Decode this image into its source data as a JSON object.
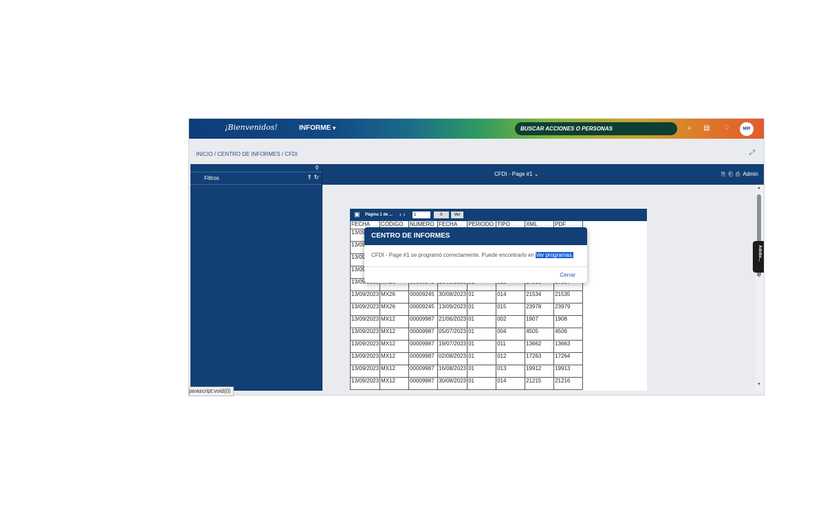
{
  "header": {
    "logo": "¡Bienvenidos!",
    "menu_label": "INFORME",
    "search_placeholder": "BUSCAR ACCIONES O PERSONAS",
    "avatar": "MIR"
  },
  "breadcrumb": "INICIO / CENTRO DE INFORMES / CFDI",
  "left_panel": {
    "title": "Filtros"
  },
  "report_bar": {
    "title": "CFDI - Page #1",
    "user": "Admin"
  },
  "pager": {
    "label": "Página 1 de ...",
    "page_value": "1",
    "go_label": "Ir",
    "view_label": "Ver"
  },
  "table": {
    "headers": [
      "FECHA",
      "CODIGO",
      "NUMERO",
      "FECHA",
      "PERIODO",
      "TIPO",
      "XML",
      "PDF"
    ],
    "rows": [
      [
        "13/09",
        "",
        "",
        "",
        "",
        "",
        "",
        ""
      ],
      [
        "13/09",
        "",
        "",
        "",
        "",
        "",
        "",
        ""
      ],
      [
        "13/09",
        "",
        "",
        "",
        "",
        "",
        "",
        ""
      ],
      [
        "13/09",
        "",
        "",
        "",
        "",
        "",
        "",
        ""
      ],
      [
        "13/09/2023",
        "MX26",
        "00009245",
        "16/08/2023",
        "01",
        "013",
        "17896",
        "17897"
      ],
      [
        "13/09/2023",
        "MX26",
        "00009245",
        "30/08/2023",
        "01",
        "014",
        "21534",
        "21535"
      ],
      [
        "13/09/2023",
        "MX26",
        "00009245",
        "13/09/2023",
        "01",
        "015",
        "23978",
        "23979"
      ],
      [
        "13/09/2023",
        "MX12",
        "00009987",
        "21/06/2023",
        "01",
        "002",
        "1907",
        "1908"
      ],
      [
        "13/09/2023",
        "MX12",
        "00009987",
        "05/07/2023",
        "01",
        "004",
        "4505",
        "4506"
      ],
      [
        "13/09/2023",
        "MX12",
        "00009987",
        "19/07/2023",
        "01",
        "011",
        "13662",
        "13663"
      ],
      [
        "13/09/2023",
        "MX12",
        "00009987",
        "02/08/2023",
        "01",
        "012",
        "17263",
        "17264"
      ],
      [
        "13/09/2023",
        "MX12",
        "00009987",
        "16/08/2023",
        "01",
        "013",
        "19912",
        "19913"
      ],
      [
        "13/09/2023",
        "MX12",
        "00009987",
        "30/08/2023",
        "01",
        "014",
        "21215",
        "21216"
      ]
    ]
  },
  "modal": {
    "title": "CENTRO DE INFORMES",
    "message": "CFDI - Page #1 se programó correctamente. Puede encontrarlo en",
    "link": "Ver programas.",
    "close_label": "Cerrar"
  },
  "adobe_tab": "Adobe...",
  "status_bar": "javascript:void(0)"
}
